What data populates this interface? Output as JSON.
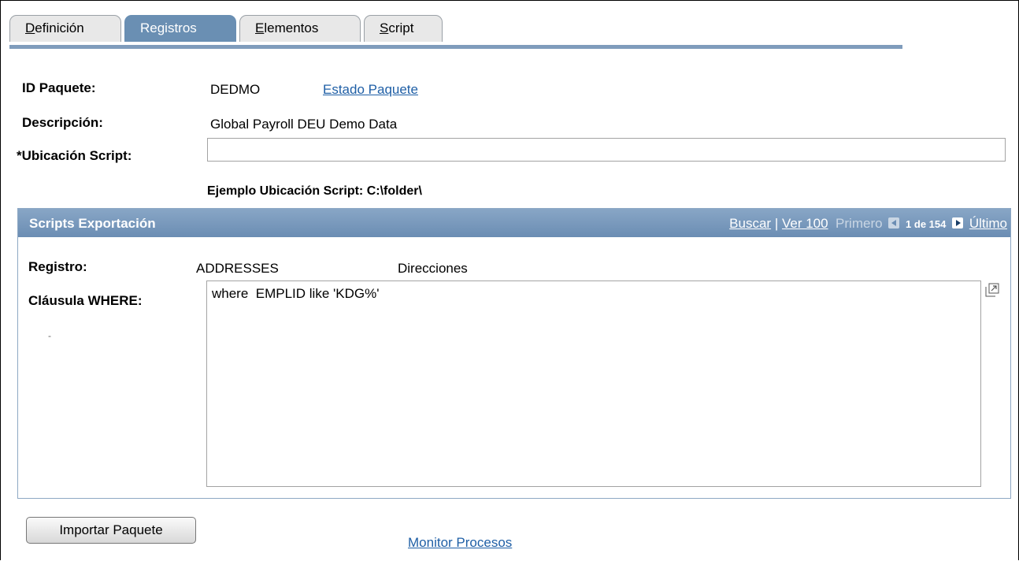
{
  "tabs": [
    {
      "label": "Definición",
      "underline": "D",
      "rest": "efinición",
      "active": false
    },
    {
      "label": "Registros",
      "underline": "",
      "rest": "Registros",
      "active": true
    },
    {
      "label": "Elementos",
      "underline": "E",
      "rest": "lementos",
      "active": false
    },
    {
      "label": "Script",
      "underline": "S",
      "rest": "cript",
      "active": false
    }
  ],
  "form": {
    "package_id_label": "ID Paquete:",
    "package_id_value": "DEDMO",
    "package_status_link": "Estado Paquete",
    "description_label": "Descripción:",
    "description_value": "Global Payroll DEU Demo Data",
    "script_location_label": "*Ubicación Script:",
    "script_location_value": "",
    "script_location_example": "Ejemplo Ubicación Script: C:\\folder\\"
  },
  "grid": {
    "title": "Scripts Exportación",
    "nav": {
      "search": "Buscar",
      "separator": "|",
      "view": "Ver 100",
      "first": "Primero",
      "count": "1 de 154",
      "last": "Último"
    },
    "record_label": "Registro:",
    "record_value": "ADDRESSES",
    "record_description": "Direcciones",
    "where_label": "Cláusula WHERE:",
    "where_value": "where  EMPLID like 'KDG%'",
    "dash": "-"
  },
  "footer": {
    "import_button": "Importar Paquete",
    "process_monitor_link": "Monitor Procesos"
  },
  "colors": {
    "tab_active": "#6a8fb3",
    "header": "#7f9cbc",
    "link": "#1f5fa6"
  }
}
